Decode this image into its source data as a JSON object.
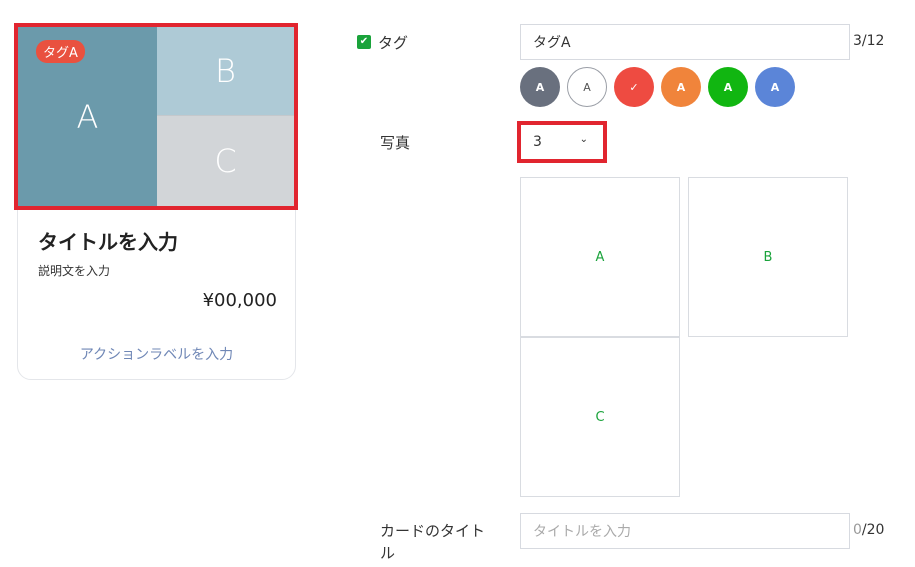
{
  "preview": {
    "tag_label": "タグA",
    "tiles": [
      "A",
      "B",
      "C"
    ],
    "title": "タイトルを入力",
    "description": "説明文を入力",
    "price": "¥00,000",
    "action_label": "アクションラベルを入力"
  },
  "form": {
    "tag": {
      "checkbox_label": "タグ",
      "value": "タグA",
      "counter_current": "3",
      "counter_max": "/12",
      "swatches": [
        {
          "label": "A",
          "color": "#69707e",
          "selected": false
        },
        {
          "label": "A",
          "color": "#ffffff",
          "selected": false
        },
        {
          "label": "✓",
          "color": "#ee4b41",
          "selected": true
        },
        {
          "label": "A",
          "color": "#f0843b",
          "selected": false
        },
        {
          "label": "A",
          "color": "#11b611",
          "selected": false
        },
        {
          "label": "A",
          "color": "#5b85d8",
          "selected": false
        }
      ]
    },
    "photo": {
      "label": "写真",
      "count_value": "3",
      "slots": [
        "A",
        "B",
        "C"
      ]
    },
    "card_title": {
      "label_line1": "カードのタイト",
      "label_line2": "ル",
      "placeholder": "タイトルを入力",
      "counter_current": "0",
      "counter_max": "/20"
    }
  },
  "colors": {
    "highlight": "#e1252f",
    "accent_green": "#1aa33b",
    "tile_a": "#6b9aab",
    "tile_b": "#aecad6",
    "tile_c": "#d2d5d8"
  }
}
